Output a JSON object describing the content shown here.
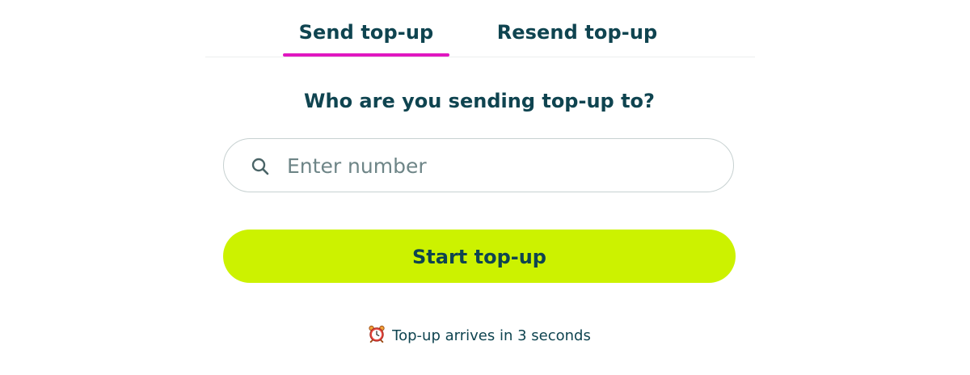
{
  "tabs": {
    "send_label": "Send top-up",
    "resend_label": "Resend top-up",
    "active": "send"
  },
  "main": {
    "question": "Who are you sending top-up to?",
    "search": {
      "icon": "search-icon",
      "placeholder": "Enter number",
      "value": ""
    },
    "start_button_label": "Start top-up",
    "note": {
      "icon": "alarm-clock-icon",
      "text": "Top-up arrives in 3 seconds"
    }
  },
  "colors": {
    "text": "#0f4450",
    "tab_underline": "#e016c0",
    "button_bg": "#ccf200",
    "input_border": "#c7d1d1",
    "placeholder": "#6e8587"
  }
}
